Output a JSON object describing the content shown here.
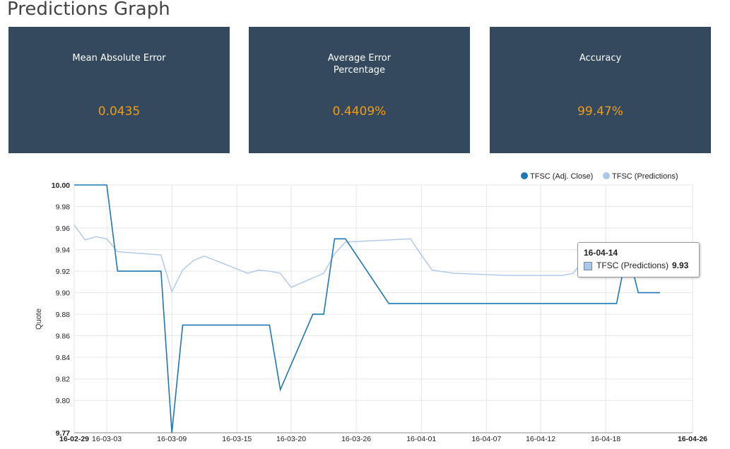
{
  "page": {
    "title": "Predictions Graph"
  },
  "cards": [
    {
      "label": "Mean Absolute Error",
      "value": "0.0435"
    },
    {
      "label": "Average Error Percentage",
      "value": "0.4409%"
    },
    {
      "label": "Accuracy",
      "value": "99.47%"
    }
  ],
  "tooltip": {
    "date": "16-04-14",
    "series": "TFSC (Predictions)",
    "value": "9.93"
  },
  "colors": {
    "card_bg": "#34495e",
    "card_value": "#f39c12",
    "adj_close": "#1f77b4",
    "predictions": "#aec7e8"
  },
  "chart_data": {
    "type": "line",
    "ylabel": "Quote",
    "xlabel": "",
    "ylim": [
      9.77,
      10.0
    ],
    "xlim": [
      "16-02-29",
      "16-04-26"
    ],
    "yticks": [
      "10.00",
      "9.98",
      "9.96",
      "9.94",
      "9.92",
      "9.90",
      "9.88",
      "9.86",
      "9.84",
      "9.82",
      "9.80",
      "9.77"
    ],
    "xticks": [
      "16-02-29",
      "16-03-03",
      "16-03-09",
      "16-03-15",
      "16-03-20",
      "16-03-26",
      "16-04-01",
      "16-04-07",
      "16-04-12",
      "16-04-18",
      "16-04-26"
    ],
    "grid": true,
    "legend_position": "top-right",
    "series": [
      {
        "name": "TFSC (Adj. Close)",
        "color": "#1f77b4",
        "points": [
          [
            "16-02-29",
            10.0
          ],
          [
            "16-03-03",
            10.0
          ],
          [
            "16-03-04",
            9.92
          ],
          [
            "16-03-08",
            9.92
          ],
          [
            "16-03-09",
            9.77
          ],
          [
            "16-03-10",
            9.87
          ],
          [
            "16-03-18",
            9.87
          ],
          [
            "16-03-19",
            9.81
          ],
          [
            "16-03-22",
            9.88
          ],
          [
            "16-03-23",
            9.88
          ],
          [
            "16-03-24",
            9.95
          ],
          [
            "16-03-25",
            9.95
          ],
          [
            "16-03-29",
            9.89
          ],
          [
            "16-04-19",
            9.89
          ],
          [
            "16-04-20",
            9.94
          ],
          [
            "16-04-21",
            9.9
          ],
          [
            "16-04-23",
            9.9
          ]
        ]
      },
      {
        "name": "TFSC (Predictions)",
        "color": "#aec7e8",
        "points": [
          [
            "16-02-29",
            9.963
          ],
          [
            "16-03-01",
            9.949
          ],
          [
            "16-03-02",
            9.952
          ],
          [
            "16-03-03",
            9.95
          ],
          [
            "16-03-04",
            9.938
          ],
          [
            "16-03-08",
            9.935
          ],
          [
            "16-03-09",
            9.901
          ],
          [
            "16-03-10",
            9.921
          ],
          [
            "16-03-11",
            9.93
          ],
          [
            "16-03-12",
            9.934
          ],
          [
            "16-03-16",
            9.918
          ],
          [
            "16-03-17",
            9.921
          ],
          [
            "16-03-18",
            9.92
          ],
          [
            "16-03-19",
            9.918
          ],
          [
            "16-03-20",
            9.905
          ],
          [
            "16-03-23",
            9.918
          ],
          [
            "16-03-24",
            9.936
          ],
          [
            "16-03-25",
            9.947
          ],
          [
            "16-03-31",
            9.95
          ],
          [
            "16-04-01",
            9.935
          ],
          [
            "16-04-02",
            9.921
          ],
          [
            "16-04-04",
            9.918
          ],
          [
            "16-04-09",
            9.916
          ],
          [
            "16-04-14",
            9.916
          ],
          [
            "16-04-15",
            9.918
          ],
          [
            "16-04-16",
            9.931
          ],
          [
            "16-04-17",
            9.944
          ],
          [
            "16-04-18",
            9.932
          ],
          [
            "16-04-21",
            9.932
          ],
          [
            "16-04-22",
            9.936
          ],
          [
            "16-04-23",
            9.93
          ],
          [
            "16-04-26",
            9.944
          ]
        ]
      }
    ],
    "highlight": {
      "series": "TFSC (Predictions)",
      "x": "16-04-16",
      "y": 9.931
    }
  }
}
